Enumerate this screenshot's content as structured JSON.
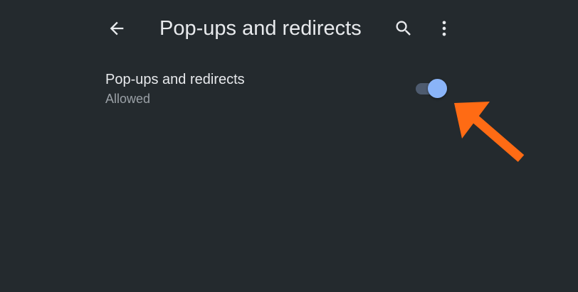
{
  "header": {
    "back_icon": "arrow-back-icon",
    "title": "Pop-ups and redirects",
    "search_icon": "search-icon",
    "more_icon": "more-vert-icon"
  },
  "setting": {
    "title": "Pop-ups and redirects",
    "subtitle": "Allowed",
    "toggle_on": true
  },
  "annotation": {
    "icon": "annotation-arrow-icon",
    "color": "#ff6b14"
  },
  "colors": {
    "background": "#242a2e",
    "accent": "#8ab4f8",
    "text_primary": "#e8eaed",
    "text_secondary": "#9aa0a6"
  }
}
